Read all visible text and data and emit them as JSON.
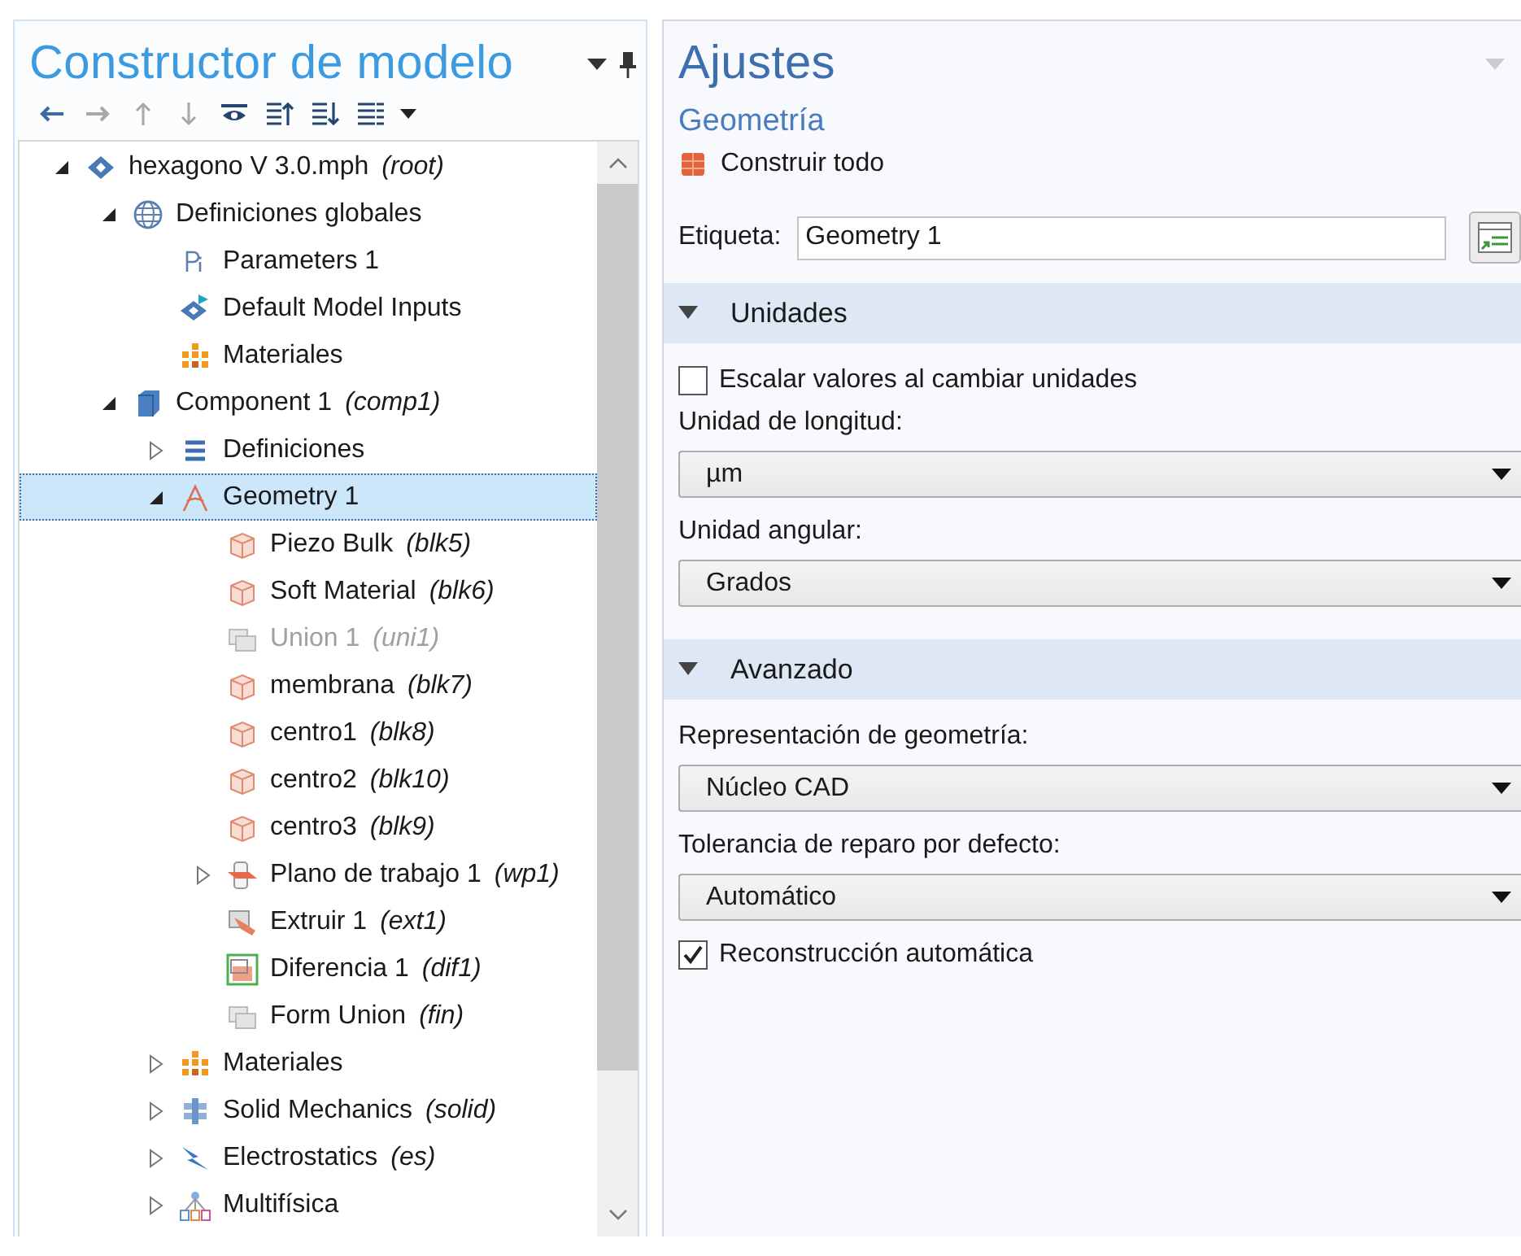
{
  "model_builder": {
    "title": "Constructor de modelo",
    "toolbar": [
      {
        "kind": "back",
        "disabled": false
      },
      {
        "kind": "forward",
        "disabled": true
      },
      {
        "kind": "up",
        "disabled": true
      },
      {
        "kind": "down",
        "disabled": true
      },
      {
        "kind": "eye",
        "disabled": false
      },
      {
        "kind": "collapse",
        "disabled": false
      },
      {
        "kind": "expand",
        "disabled": false
      },
      {
        "kind": "list",
        "disabled": false
      },
      {
        "kind": "caret",
        "disabled": false
      }
    ],
    "tree": [
      {
        "label": "hexagono  V 3.0.mph",
        "tag": "(root)",
        "kind": "model",
        "expanded": true,
        "selected": false,
        "disabled": false,
        "children": [
          {
            "label": "Definiciones globales",
            "kind": "globe",
            "expanded": true,
            "selected": false,
            "disabled": false,
            "children": [
              {
                "label": "Parameters 1",
                "kind": "params",
                "selected": false,
                "disabled": false
              },
              {
                "label": "Default Model Inputs",
                "kind": "inputs",
                "selected": false,
                "disabled": false
              },
              {
                "label": "Materiales",
                "kind": "materials",
                "selected": false,
                "disabled": false
              }
            ]
          },
          {
            "label": "Component 1",
            "tag": "(comp1)",
            "kind": "component",
            "expanded": true,
            "selected": false,
            "disabled": false,
            "children": [
              {
                "label": "Definiciones",
                "kind": "list",
                "expanded": false,
                "selected": false,
                "disabled": false
              },
              {
                "label": "Geometry 1",
                "kind": "geometry",
                "expanded": true,
                "selected": true,
                "disabled": false,
                "children": [
                  {
                    "label": "Piezo Bulk",
                    "tag": "(blk5)",
                    "kind": "block",
                    "selected": false,
                    "disabled": false
                  },
                  {
                    "label": "Soft Material",
                    "tag": "(blk6)",
                    "kind": "block",
                    "selected": false,
                    "disabled": false
                  },
                  {
                    "label": "Union 1",
                    "tag": "(uni1)",
                    "kind": "union",
                    "selected": false,
                    "disabled": true
                  },
                  {
                    "label": "membrana",
                    "tag": "(blk7)",
                    "kind": "block",
                    "selected": false,
                    "disabled": false
                  },
                  {
                    "label": "centro1",
                    "tag": "(blk8)",
                    "kind": "block",
                    "selected": false,
                    "disabled": false
                  },
                  {
                    "label": "centro2",
                    "tag": "(blk10)",
                    "kind": "block",
                    "selected": false,
                    "disabled": false
                  },
                  {
                    "label": "centro3",
                    "tag": "(blk9)",
                    "kind": "block",
                    "selected": false,
                    "disabled": false
                  },
                  {
                    "label": "Plano de trabajo 1",
                    "tag": "(wp1)",
                    "kind": "workplane",
                    "expanded": false,
                    "selected": false,
                    "disabled": false
                  },
                  {
                    "label": "Extruir 1",
                    "tag": "(ext1)",
                    "kind": "extrude",
                    "selected": false,
                    "disabled": false
                  },
                  {
                    "label": "Diferencia 1",
                    "tag": "(dif1)",
                    "kind": "difference",
                    "selected": false,
                    "disabled": false
                  },
                  {
                    "label": "Form Union",
                    "tag": "(fin)",
                    "kind": "union",
                    "selected": false,
                    "disabled": false
                  }
                ]
              },
              {
                "label": "Materiales",
                "kind": "materials",
                "expanded": false,
                "selected": false,
                "disabled": false
              },
              {
                "label": "Solid Mechanics",
                "tag": "(solid)",
                "kind": "solid",
                "expanded": false,
                "selected": false,
                "disabled": false
              },
              {
                "label": "Electrostatics",
                "tag": "(es)",
                "kind": "electro",
                "expanded": false,
                "selected": false,
                "disabled": false
              },
              {
                "label": "Multifísica",
                "kind": "multiphysics",
                "expanded": false,
                "selected": false,
                "disabled": false
              }
            ]
          }
        ]
      }
    ]
  },
  "settings": {
    "title": "Ajustes",
    "subtitle": "Geometría",
    "build_button": "Construir todo",
    "label_field": {
      "label": "Etiqueta:",
      "value": "Geometry 1"
    },
    "sections": [
      {
        "title": "Unidades",
        "expanded": true,
        "items": [
          {
            "kind": "checkbox",
            "label": "Escalar valores al cambiar unidades",
            "checked": false
          },
          {
            "kind": "select",
            "label": "Unidad de longitud:",
            "value": "µm"
          },
          {
            "kind": "select",
            "label": "Unidad angular:",
            "value": "Grados"
          }
        ]
      },
      {
        "title": "Avanzado",
        "expanded": true,
        "items": [
          {
            "kind": "select",
            "label": "Representación de geometría:",
            "value": "Núcleo CAD"
          },
          {
            "kind": "select",
            "label": "Tolerancia de reparo por defecto:",
            "value": "Automático"
          },
          {
            "kind": "checkbox",
            "label": "Reconstrucción automática",
            "checked": true
          }
        ]
      }
    ]
  }
}
